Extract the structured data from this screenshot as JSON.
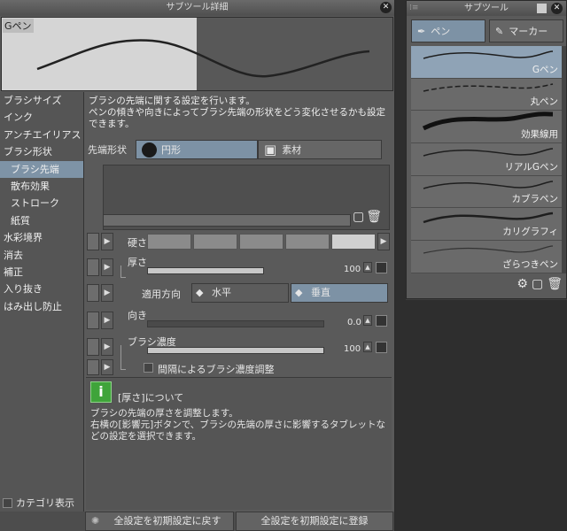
{
  "dialog": {
    "title": "サブツール詳細",
    "preview_name": "Gペン",
    "categories": [
      "ブラシサイズ",
      "インク",
      "アンチエイリアス",
      "ブラシ形状",
      "ブラシ先端",
      "散布効果",
      "ストローク",
      "紙質",
      "水彩境界",
      "消去",
      "補正",
      "入り抜き",
      "はみ出し防止"
    ],
    "category_display": "カテゴリ表示",
    "description": "ブラシの先端に関する設定を行います。\nペンの傾きや向きによってブラシ先端の形状をどう変化させるかも設定できます。",
    "tip_shape_label": "先端形状",
    "tip_circle": "円形",
    "tip_material": "素材",
    "hardness_label": "硬さ",
    "thickness_label": "厚さ",
    "thickness_value": "100",
    "apply_direction_label": "適用方向",
    "dir_horizontal": "水平",
    "dir_vertical": "垂直",
    "direction_label": "向き",
    "direction_value": "0.0",
    "density_label": "ブラシ濃度",
    "density_value": "100",
    "interval_density_label": "間隔によるブラシ濃度調整",
    "info_title": "[厚さ]について",
    "info_body": "ブラシの先端の厚さを調整します。\n右横の[影響元]ボタンで、ブラシの先端の厚さに影響するタブレットなどの設定を選択できます。",
    "reset_button": "全設定を初期設定に戻す",
    "register_button": "全設定を初期設定に登録"
  },
  "panel": {
    "title": "サブツール",
    "tab_pen": "ペン",
    "tab_marker": "マーカー",
    "items": [
      "Gペン",
      "丸ペン",
      "効果線用",
      "リアルGペン",
      "カブラペン",
      "カリグラフィ",
      "ざらつきペン"
    ]
  },
  "colors": {
    "accent": "#7d92a5",
    "background": "#5a5a5a",
    "info_green": "#3fa43a"
  }
}
